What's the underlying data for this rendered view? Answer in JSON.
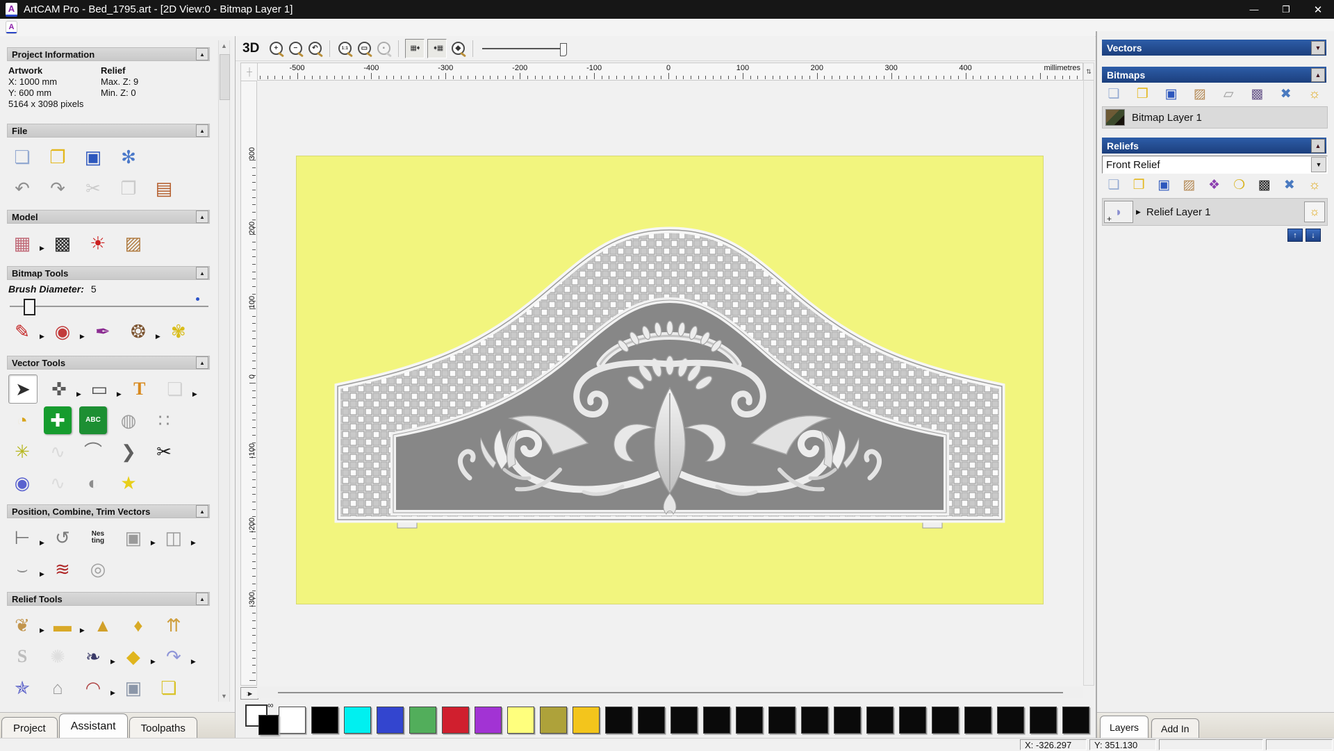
{
  "window": {
    "title": "ArtCAM Pro - Bed_1795.art - [2D View:0 - Bitmap Layer 1]",
    "controls": [
      {
        "n": "minimize-button",
        "g": "—"
      },
      {
        "n": "maximize-button",
        "g": "❐"
      },
      {
        "n": "close-button",
        "g": "✕"
      }
    ]
  },
  "left_panel": {
    "project_info": {
      "artwork_label": "Artwork",
      "artwork_x": "X: 1000 mm",
      "artwork_y": "Y: 600 mm",
      "pixels": "5164 x 3098 pixels",
      "relief_label": "Relief",
      "relief_max": "Max. Z: 9",
      "relief_min": "Min. Z: 0"
    },
    "brush": {
      "label": "Brush Diameter:",
      "value": "5"
    },
    "sections": [
      {
        "title": "Project Information",
        "rows": []
      },
      {
        "title": "File",
        "rows": [
          [
            {
              "n": "new-model",
              "g": "❏",
              "c": "#93a9d1"
            },
            {
              "n": "open-model",
              "g": "❐",
              "c": "#e3b71d"
            },
            {
              "n": "save-model",
              "g": "▣",
              "c": "#2d57bd"
            },
            {
              "n": "model-wizard",
              "g": "✻",
              "c": "#4b79c9"
            }
          ],
          [
            {
              "n": "undo",
              "g": "↶",
              "c": "#8f8f8f"
            },
            {
              "n": "redo",
              "g": "↷",
              "c": "#8f8f8f"
            },
            {
              "n": "cut",
              "g": "✂",
              "c": "#9a9a9a",
              "d": true
            },
            {
              "n": "copy",
              "g": "❐",
              "c": "#9a9a9a",
              "d": true
            },
            {
              "n": "paste",
              "g": "▤",
              "c": "#b35b2a"
            }
          ]
        ]
      },
      {
        "title": "Model",
        "rows": [
          [
            {
              "n": "set-model-size",
              "g": "▦",
              "c": "#c06a78",
              "f": true
            },
            {
              "n": "greyscale-model",
              "g": "▩",
              "c": "#2b2b2b"
            },
            {
              "n": "model-lighting",
              "g": "☀",
              "c": "#cc2020"
            },
            {
              "n": "add-texture-relief",
              "g": "▨",
              "c": "#b07c42"
            }
          ]
        ]
      },
      {
        "title": "Bitmap Tools",
        "rows": [
          [
            {
              "n": "paint-brush",
              "g": "✎",
              "c": "#c32222",
              "f": true
            },
            {
              "n": "flood-fill",
              "g": "◉",
              "c": "#c23a3a",
              "f": true
            },
            {
              "n": "pick-colour",
              "g": "✒",
              "c": "#8c2d92"
            },
            {
              "n": "colour-palette",
              "g": "❂",
              "c": "#7c5430",
              "f": true
            },
            {
              "n": "bitmap-to-vector",
              "g": "✾",
              "c": "#d9bd1c"
            }
          ]
        ]
      },
      {
        "title": "Vector Tools",
        "rows": [
          [
            {
              "n": "select-vectors",
              "g": "➤",
              "c": "#2e2e2e",
              "a": true
            },
            {
              "n": "transform-vectors",
              "g": "✜",
              "c": "#5a5a5a",
              "f": true
            },
            {
              "n": "create-rectangle",
              "g": "▭",
              "c": "#4e4e4e",
              "f": true
            },
            {
              "n": "create-text",
              "g": "T",
              "t": "big",
              "c": "#d8891e"
            },
            {
              "n": "wrap-vectors",
              "g": "❏",
              "c": "#ababab",
              "d": true,
              "f": true
            }
          ],
          [
            {
              "n": "measure-tool",
              "g": "◔",
              "c": "#d8a41c"
            },
            {
              "n": "create-polyline",
              "g": "✚",
              "c": "#ffffff",
              "bg": "#169c2e"
            },
            {
              "n": "paste-text-block",
              "g": "ABC",
              "t": "text",
              "bg": "#1d8f33",
              "c": "#ffffff"
            },
            {
              "n": "create-mesh",
              "g": "◍",
              "c": "#9d9d9d"
            },
            {
              "n": "snap-points",
              "g": "∷",
              "c": "#8f8f8f"
            }
          ],
          [
            {
              "n": "node-editing",
              "g": "✳",
              "c": "#b7b71f"
            },
            {
              "n": "free-sketch",
              "g": "∿",
              "c": "#bdbdbd",
              "d": true
            },
            {
              "n": "arc-fit",
              "g": "⌒",
              "c": "#7a7a7a"
            },
            {
              "n": "offset-vector",
              "g": "❯",
              "c": "#5f5f5f"
            },
            {
              "n": "trim-vectors",
              "g": "✂",
              "c": "#1b1b1b"
            }
          ],
          [
            {
              "n": "create-dome",
              "g": "◉",
              "c": "#5a62cf"
            },
            {
              "n": "fit-curve",
              "g": "∿",
              "c": "#c2c2c2",
              "d": true
            },
            {
              "n": "mirror-vectors",
              "g": "◐",
              "c": "#8d8d8d"
            },
            {
              "n": "create-star",
              "g": "★",
              "c": "#e8cf1a"
            }
          ]
        ]
      },
      {
        "title": "Position, Combine, Trim Vectors",
        "rows": [
          [
            {
              "n": "align-vectors",
              "g": "⊢",
              "c": "#6f6f6f",
              "f": true
            },
            {
              "n": "text-on-curve",
              "g": "↺",
              "c": "#7d7d7d"
            },
            {
              "n": "nesting",
              "g": "Nes\nting",
              "t": "text",
              "c": "#1f1f1f"
            },
            {
              "n": "group-vectors",
              "g": "▣",
              "c": "#9a9a9a",
              "f": true
            },
            {
              "n": "weld-vectors",
              "g": "◫",
              "c": "#9a9a9a",
              "f": true
            }
          ],
          [
            {
              "n": "join-vectors",
              "g": "⌣",
              "c": "#8e8e8e",
              "f": true
            },
            {
              "n": "vector-texture",
              "g": "≋",
              "c": "#b02a2a"
            },
            {
              "n": "unwrap-vectors",
              "g": "◎",
              "c": "#a0a0a0"
            }
          ]
        ]
      },
      {
        "title": "Relief Tools",
        "rows": [
          [
            {
              "n": "relief-clipart",
              "g": "❦",
              "c": "#c2954d",
              "f": true
            },
            {
              "n": "create-shape",
              "g": "▬",
              "c": "#d9a928",
              "f": true
            },
            {
              "n": "shape-editor",
              "g": "▲",
              "c": "#d1a02a"
            },
            {
              "n": "two-rail-sweep",
              "g": "♦",
              "c": "#d8aa25"
            },
            {
              "n": "extrude-relief",
              "g": "⇈",
              "c": "#cfa040"
            }
          ],
          [
            {
              "n": "sculpting",
              "g": "S",
              "t": "big",
              "c": "#bdbdbd"
            },
            {
              "n": "weave-wizard",
              "g": "✺",
              "c": "#c9c9c9",
              "d": true
            },
            {
              "n": "face-wizard",
              "g": "❧",
              "c": "#3a3a68",
              "f": true
            },
            {
              "n": "texture-flow",
              "g": "◆",
              "c": "#e0b51e",
              "f": true
            },
            {
              "n": "offset-relief",
              "g": "↷",
              "c": "#8f95d8",
              "f": true
            }
          ],
          [
            {
              "n": "texture-relief",
              "g": "✯",
              "c": "#5d63c9"
            },
            {
              "n": "iso-form",
              "g": "⌂",
              "c": "#9a9a9a"
            },
            {
              "n": "swept-profile",
              "g": "◠",
              "c": "#b04545",
              "f": true
            },
            {
              "n": "emboss-relief",
              "g": "▣",
              "c": "#8b96a8"
            },
            {
              "n": "relief-layer-stack",
              "g": "❏",
              "c": "#d9c32a"
            }
          ],
          [
            {
              "n": "smooth-relief",
              "g": "◗",
              "c": "#bf2222"
            },
            {
              "n": "relief-envelope",
              "g": "▤",
              "c": "#9d9d9d"
            },
            {
              "n": "dome-tool",
              "g": "▲",
              "c": "#6a6fd0"
            },
            {
              "n": "texture-ball",
              "g": "●",
              "c": "#3f7fd0"
            },
            {
              "n": "leaf-tool",
              "g": "♠",
              "c": "#cfc21e"
            }
          ]
        ]
      }
    ],
    "tabs": [
      {
        "label": "Project",
        "active": false
      },
      {
        "label": "Assistant",
        "active": true
      },
      {
        "label": "Toolpaths",
        "active": false
      }
    ]
  },
  "canvas": {
    "toolbar": [
      {
        "n": "view-3d-button",
        "t": "label",
        "g": "3D"
      },
      {
        "n": "zoom-in-button",
        "t": "mag",
        "g": "+"
      },
      {
        "n": "zoom-out-button",
        "t": "mag",
        "g": "−"
      },
      {
        "n": "zoom-previous-button",
        "t": "mag",
        "g": "↶"
      },
      {
        "t": "sep"
      },
      {
        "n": "zoom-1to1-button",
        "t": "mag",
        "g": "1:1",
        "tiny": true
      },
      {
        "n": "zoom-fit-button",
        "t": "mag",
        "g": "▭"
      },
      {
        "n": "zoom-selection-button",
        "t": "mag",
        "g": "▪",
        "d": true
      },
      {
        "t": "sep"
      },
      {
        "n": "toggle-bitmap-visibility-button",
        "t": "toggle",
        "g": "▦➧"
      },
      {
        "n": "toggle-vector-visibility-button",
        "t": "toggle",
        "g": "➧▦"
      },
      {
        "n": "relief-preview-button",
        "t": "mag",
        "g": "◆"
      },
      {
        "t": "sep"
      },
      {
        "n": "contrast-slider",
        "t": "slider"
      }
    ],
    "ruler": {
      "unit": "millimetres",
      "h_labels": [
        "-500",
        "-400",
        "-300",
        "-200",
        "-100",
        "0",
        "100",
        "200",
        "300",
        "400"
      ],
      "v_labels": [
        "300",
        "200",
        "100",
        "0",
        "-100",
        "-200",
        "-300"
      ]
    },
    "artwork": {
      "canvas_color": "#f2f57e",
      "panel_color": "#878787",
      "weave_light": "#fbfbfb",
      "weave_dark": "#c9c9c9",
      "description": "Bed headboard relief with basket-weave ground and acanthus scroll ornament"
    }
  },
  "right_panel": {
    "vectors": {
      "title": "Vectors",
      "btn": "▼"
    },
    "bitmaps": {
      "title": "Bitmaps",
      "btn": "▲",
      "tools": [
        {
          "n": "new-bitmap-layer",
          "g": "❏",
          "c": "#93a9d1"
        },
        {
          "n": "open-bitmap-layer",
          "g": "❐",
          "c": "#e3b71d"
        },
        {
          "n": "save-bitmap-layer",
          "g": "▣",
          "c": "#2d57bd"
        },
        {
          "n": "merge-bitmap-layer",
          "g": "▨",
          "c": "#b58a55"
        },
        {
          "n": "clear-bitmap-layer",
          "g": "▱",
          "c": "#9c9c9c"
        },
        {
          "n": "bitmap-image",
          "g": "▩",
          "c": "#6b5a8c"
        },
        {
          "n": "delete-bitmap-layer",
          "g": "✖",
          "c": "#4a7ac0"
        },
        {
          "n": "toggle-all-bitmap-visibility",
          "g": "☼",
          "c": "#e0a818"
        }
      ],
      "layers": [
        {
          "name": "Bitmap Layer 1"
        }
      ]
    },
    "reliefs": {
      "title": "Reliefs",
      "btn": "▲",
      "active_relief": "Front Relief",
      "tools": [
        {
          "n": "new-relief-layer",
          "g": "❏",
          "c": "#93a9d1"
        },
        {
          "n": "open-relief-layer",
          "g": "❐",
          "c": "#e3b71d"
        },
        {
          "n": "save-relief-layer",
          "g": "▣",
          "c": "#2d57bd"
        },
        {
          "n": "merge-relief-layer",
          "g": "▨",
          "c": "#b58a55"
        },
        {
          "n": "combine-relief-layers",
          "g": "❖",
          "c": "#8c3fb0"
        },
        {
          "n": "relief-preview-page",
          "g": "❍",
          "c": "#d8b21a"
        },
        {
          "n": "greyscale-relief-view",
          "g": "▩",
          "c": "#1d1d1d"
        },
        {
          "n": "delete-relief-layer",
          "g": "✖",
          "c": "#4a7ac0"
        },
        {
          "n": "toggle-all-relief-visibility",
          "g": "☼",
          "c": "#e0a818"
        }
      ],
      "layers": [
        {
          "name": "Relief Layer 1"
        }
      ]
    },
    "tabs": [
      {
        "label": "Layers",
        "active": true
      },
      {
        "label": "Add In",
        "active": false
      }
    ]
  },
  "palette": {
    "colors": [
      "#ffffff",
      "#000000",
      "#00f0f0",
      "#3345cf",
      "#52ae5b",
      "#d01f2e",
      "#a233d4",
      "#ffff7d",
      "#aea23a",
      "#f3c51c",
      "#0a0a0a",
      "#0a0a0a",
      "#0a0a0a",
      "#0a0a0a",
      "#0a0a0a",
      "#0a0a0a",
      "#0a0a0a",
      "#0a0a0a",
      "#0a0a0a",
      "#0a0a0a",
      "#0a0a0a",
      "#0a0a0a",
      "#0a0a0a",
      "#0a0a0a",
      "#0a0a0a"
    ]
  },
  "status": {
    "x": "X: -326.297",
    "y": "Y: 351.130"
  }
}
